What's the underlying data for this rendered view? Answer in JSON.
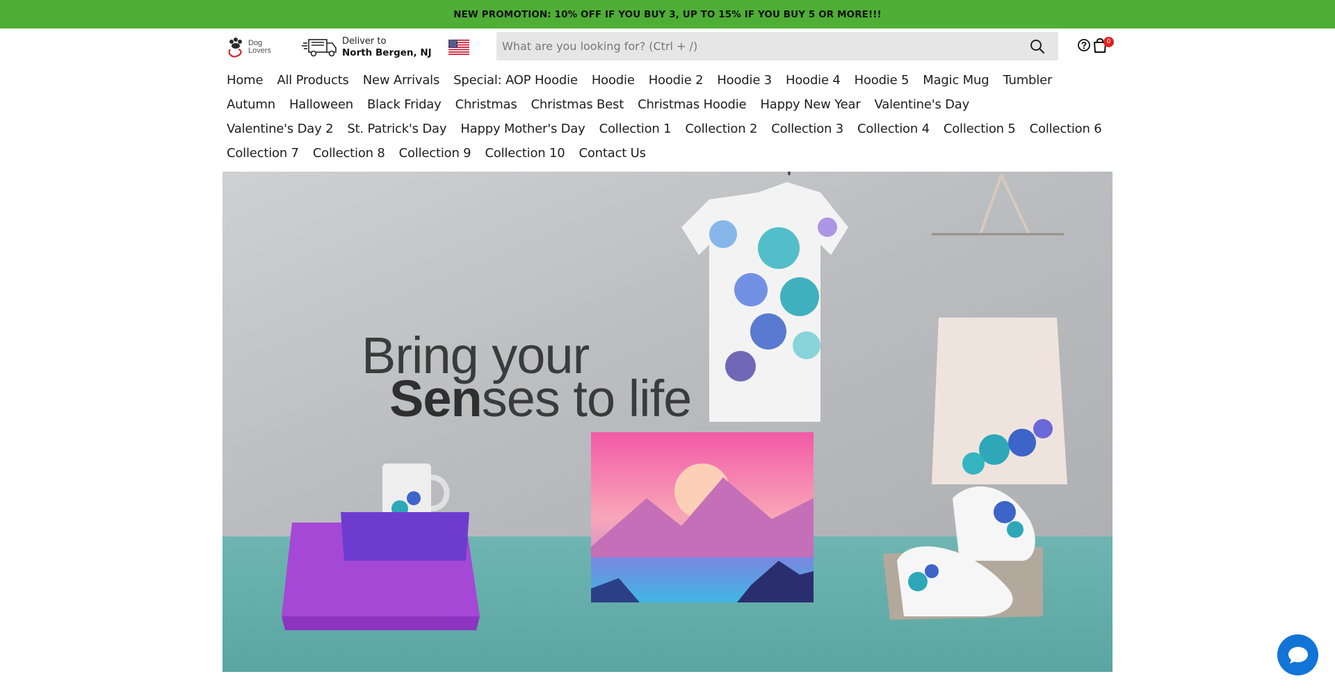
{
  "promo": {
    "text": "NEW PROMOTION: 10% OFF IF YOU BUY 3, UP TO 15% IF YOU BUY 5 OR MORE!!!"
  },
  "header": {
    "logo": {
      "line1": "Dog",
      "line2": "Lovers"
    },
    "deliver": {
      "label": "Deliver to",
      "location": "North Bergen, NJ"
    },
    "search": {
      "placeholder": "What are you looking for? (Ctrl + /)"
    },
    "cart_count": "0"
  },
  "nav": {
    "rows": [
      [
        "Home",
        "All Products",
        "New Arrivals",
        "Special: AOP Hoodie",
        "Hoodie",
        "Hoodie 2",
        "Hoodie 3",
        "Hoodie 4",
        "Hoodie 5",
        "Magic Mug",
        "Tumbler"
      ],
      [
        "Autumn",
        "Halloween",
        "Black Friday",
        "Christmas",
        "Christmas Best",
        "Christmas Hoodie",
        "Happy New Year",
        "Valentine's Day"
      ],
      [
        "Valentine's Day 2",
        "St. Patrick's Day",
        "Happy Mother's Day",
        "Collection 1",
        "Collection 2",
        "Collection 3",
        "Collection 4",
        "Collection 5",
        "Collection 6"
      ],
      [
        "Collection 7",
        "Collection 8",
        "Collection 9",
        "Collection 10",
        "Contact Us"
      ]
    ]
  },
  "hero": {
    "line1": "Bring your",
    "line2_bold": "Sen",
    "line2_rest": "ses to life"
  },
  "colors": {
    "promo_bg": "#4eae35",
    "cart_badge": "#e0211d",
    "chat_button": "#1274d6"
  },
  "icons": [
    "paw-logo-icon",
    "truck-icon",
    "us-flag-icon",
    "search-icon",
    "help-icon",
    "cart-icon",
    "chat-icon"
  ]
}
